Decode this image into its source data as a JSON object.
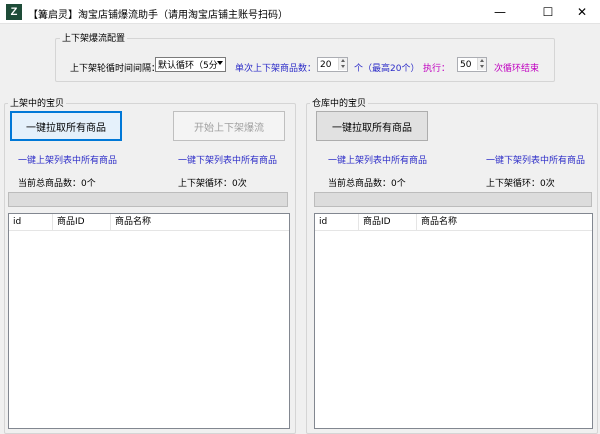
{
  "window": {
    "icon_glyph": "Z",
    "title": "【篝启灵】淘宝店铺爆流助手（请用淘宝店铺主账号扫码）",
    "controls": {
      "minimize": "—",
      "maximize": "☐",
      "close": "✕"
    }
  },
  "config": {
    "title": "上下架爆流配置",
    "interval_label": "上下架轮循时间间隔：",
    "interval_value": "默认循环（5分",
    "count_label": "单次上下架商品数：",
    "count_value": "20",
    "count_unit": "个（最高20个）",
    "exec_label": "执行：",
    "exec_value": "50",
    "exec_unit": "次循环结束"
  },
  "left": {
    "title": "上架中的宝贝",
    "fetch_button": "一键拉取所有商品",
    "start_button": "开始上下架爆流",
    "link_up": "一键上架列表中所有商品",
    "link_down": "一键下架列表中所有商品",
    "total_label": "当前总商品数：0个",
    "cycle_label": "上下架循环：0次",
    "progress": 0,
    "columns": [
      "id",
      "商品ID",
      "商品名称"
    ]
  },
  "right": {
    "title": "仓库中的宝贝",
    "fetch_button": "一键拉取所有商品",
    "link_up": "一键上架列表中所有商品",
    "link_down": "一键下架列表中所有商品",
    "total_label": "当前总商品数：0个",
    "cycle_label": "上下架循环：0次",
    "progress": 0,
    "columns": [
      "id",
      "商品ID",
      "商品名称"
    ]
  }
}
